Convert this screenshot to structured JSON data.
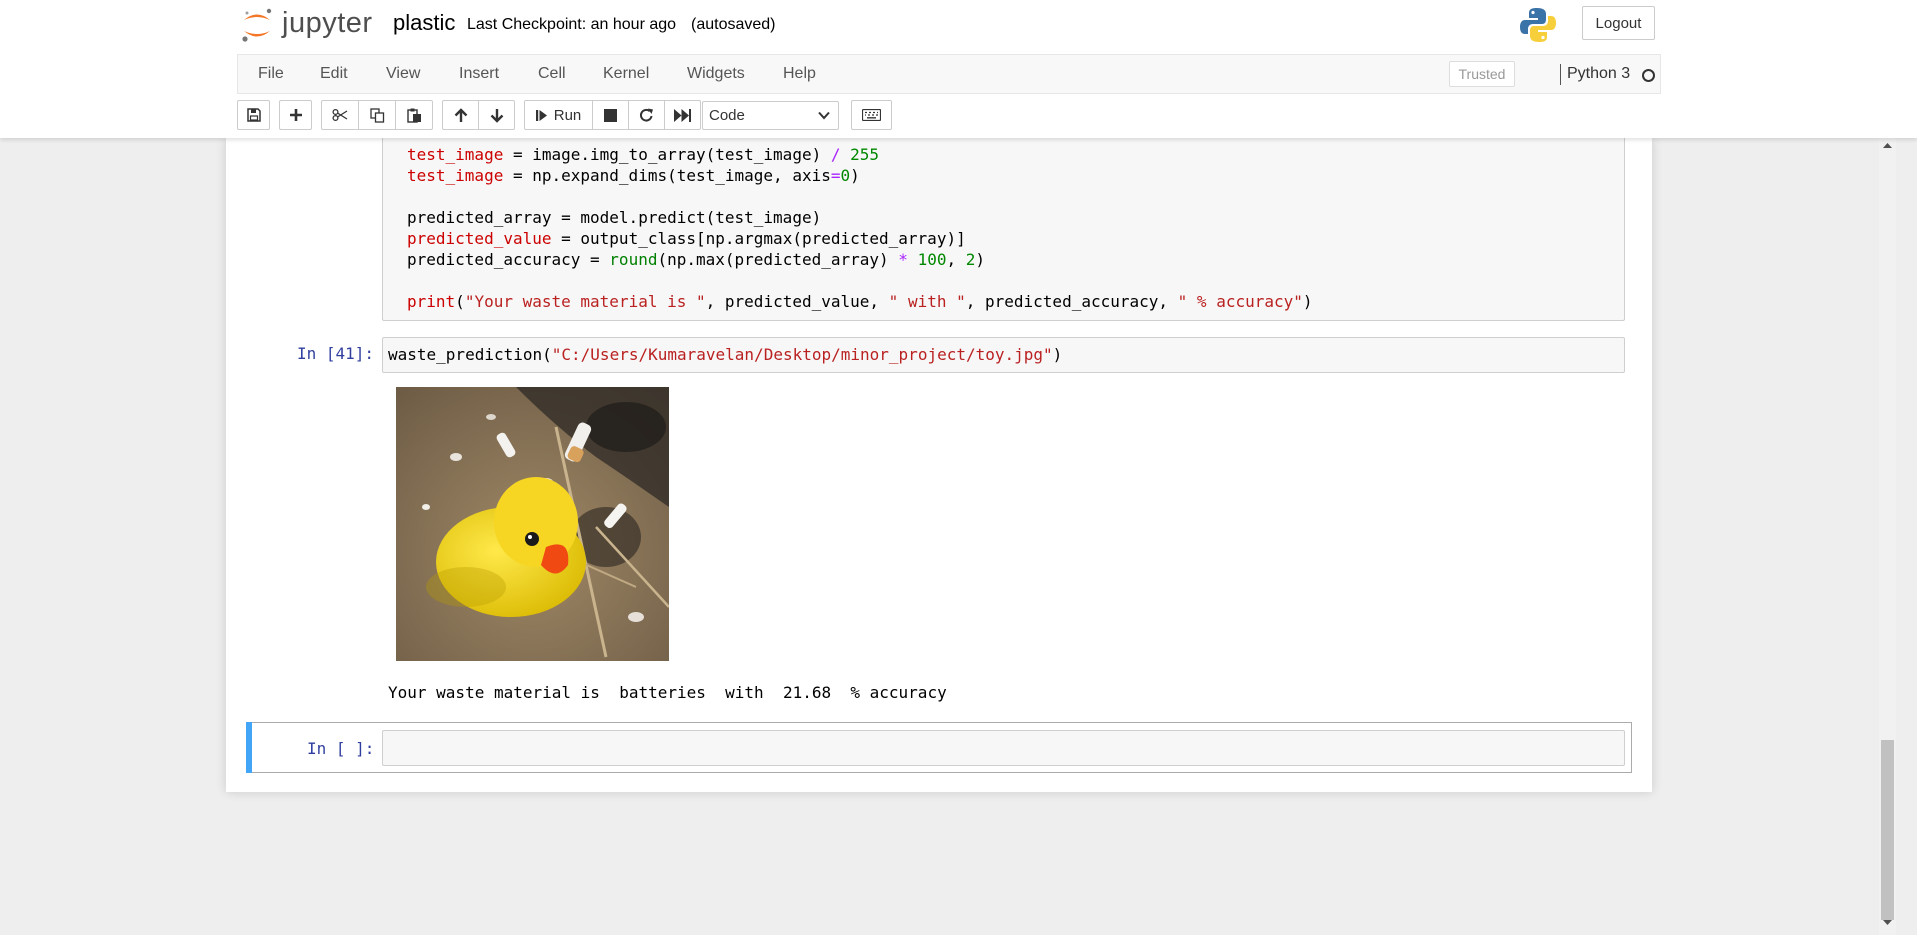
{
  "header": {
    "logo_text": "jupyter",
    "notebook_name": "plastic",
    "checkpoint": "Last Checkpoint: an hour ago",
    "autosave": "(autosaved)",
    "logout_label": "Logout"
  },
  "menu": {
    "items": [
      "File",
      "Edit",
      "View",
      "Insert",
      "Cell",
      "Kernel",
      "Widgets",
      "Help"
    ],
    "trusted": "Trusted",
    "kernel_name": "Python 3"
  },
  "toolbar": {
    "run_label": "Run",
    "cell_type": "Code",
    "icons": [
      "save-icon",
      "plus-icon",
      "cut-icon",
      "copy-icon",
      "paste-icon",
      "arrow-up-icon",
      "arrow-down-icon",
      "run-icon",
      "stop-icon",
      "restart-icon",
      "fast-forward-icon",
      "keyboard-icon"
    ]
  },
  "cells": {
    "cell1": {
      "lines": [
        "test_image = image.img_to_array(test_image) / 255",
        "test_image = np.expand_dims(test_image, axis=0)",
        "",
        "predicted_array = model.predict(test_image)",
        "predicted_value = output_class[np.argmax(predicted_array)]",
        "predicted_accuracy = round(np.max(predicted_array) * 100, 2)",
        "",
        "print(\"Your waste material is \", predicted_value, \" with \", predicted_accuracy, \" % accuracy\")"
      ]
    },
    "cell2": {
      "prompt": "In [41]:",
      "code_fn": "waste_prediction(",
      "code_str": "\"C:/Users/Kumaravelan/Desktop/minor_project/toy.jpg\"",
      "code_end": ")",
      "output_image": "yellow rubber duck on sand",
      "output_text": "Your waste material is  batteries  with  21.68  % accuracy"
    },
    "cell3": {
      "prompt": "In [ ]:",
      "code": ""
    }
  },
  "colors": {
    "selected_cell_bar": "#42a5f5",
    "prompt": "#303f9f",
    "string": "#ba2121",
    "number": "#008800",
    "operator": "#aa22ff"
  }
}
